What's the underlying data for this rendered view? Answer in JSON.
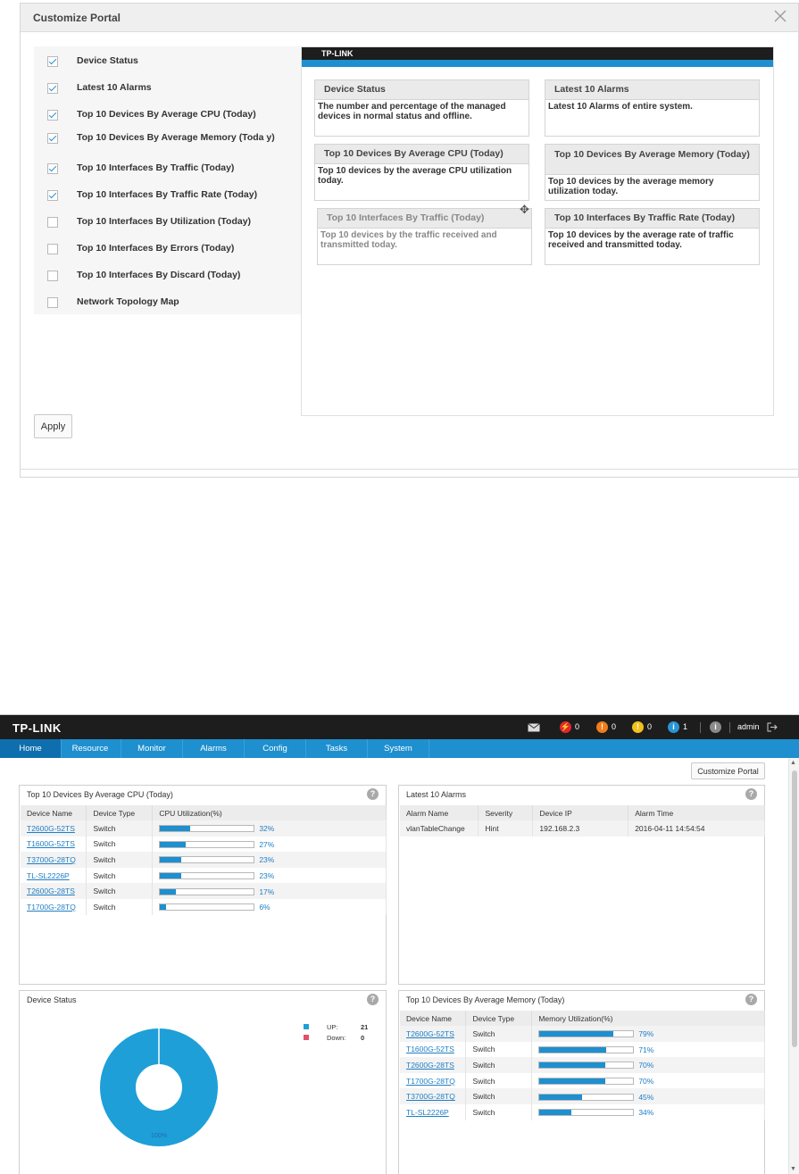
{
  "dialog": {
    "title": "Customize Portal",
    "apply_label": "Apply",
    "options": [
      {
        "label": "Device Status",
        "checked": true
      },
      {
        "label": "Latest 10 Alarms",
        "checked": true
      },
      {
        "label": "Top 10 Devices By Average CPU (Today)",
        "checked": true
      },
      {
        "label": "Top 10 Devices By Average Memory (Toda y)",
        "checked": true
      },
      {
        "label": "Top 10 Interfaces By Traffic (Today)",
        "checked": true
      },
      {
        "label": "Top 10 Interfaces By Traffic Rate (Today)",
        "checked": true
      },
      {
        "label": "Top 10 Interfaces By Utilization (Today)",
        "checked": false
      },
      {
        "label": "Top 10 Interfaces By Errors (Today)",
        "checked": false
      },
      {
        "label": "Top 10 Interfaces By Discard (Today)",
        "checked": false
      },
      {
        "label": "Network Topology Map",
        "checked": false
      }
    ],
    "preview": {
      "logo": "TP-LINK",
      "cards": [
        {
          "title": "Device Status",
          "desc": "The number and percentage of the managed devices in normal status and offline."
        },
        {
          "title": "Latest 10 Alarms",
          "desc": "Latest 10 Alarms of entire system."
        },
        {
          "title": "Top 10 Devices By Average CPU (Today)",
          "desc": "Top 10 devices by the average CPU utilization today."
        },
        {
          "title": "Top 10 Devices By Average Memory (Today)",
          "desc": "Top 10 devices by the average memory utilization today."
        },
        {
          "title": "Top 10 Interfaces By Traffic (Today)",
          "desc": "Top 10 devices by the traffic received and transmitted today."
        },
        {
          "title": "Top 10 Interfaces By Traffic Rate (Today)",
          "desc": "Top 10 devices by the average rate of traffic received and transmitted today."
        }
      ]
    }
  },
  "portal": {
    "logo": "TP-LINK",
    "status": {
      "red": "0",
      "orange": "0",
      "yellow": "0",
      "info": "1",
      "info_icon": "i",
      "user": "admin"
    },
    "nav": [
      "Home",
      "Resource",
      "Monitor",
      "Alarms",
      "Config",
      "Tasks",
      "System"
    ],
    "customize_label": "Customize Portal",
    "help_glyph": "?",
    "cpu": {
      "title": "Top 10 Devices By Average CPU (Today)",
      "headers": [
        "Device Name",
        "Device Type",
        "CPU Utilization(%)"
      ],
      "rows": [
        {
          "name": "T2600G-52TS",
          "type": "Switch",
          "util": 32,
          "pct": "32%"
        },
        {
          "name": "T1600G-52TS",
          "type": "Switch",
          "util": 27,
          "pct": "27%"
        },
        {
          "name": "T3700G-28TQ",
          "type": "Switch",
          "util": 23,
          "pct": "23%"
        },
        {
          "name": "TL-SL2226P",
          "type": "Switch",
          "util": 23,
          "pct": "23%"
        },
        {
          "name": "T2600G-28TS",
          "type": "Switch",
          "util": 17,
          "pct": "17%"
        },
        {
          "name": "T1700G-28TQ",
          "type": "Switch",
          "util": 6,
          "pct": "6%"
        }
      ]
    },
    "alarms": {
      "title": "Latest 10 Alarms",
      "headers": [
        "Alarm Name",
        "Severity",
        "Device IP",
        "Alarm Time"
      ],
      "rows": [
        {
          "name": "vlanTableChange",
          "severity": "Hint",
          "ip": "192.168.2.3",
          "time": "2016-04-11 14:54:54"
        }
      ]
    },
    "device_status": {
      "title": "Device Status",
      "legend": [
        {
          "label": "UP:",
          "value": "21",
          "color": "#1e9fd8"
        },
        {
          "label": "Down:",
          "value": "0",
          "color": "#e0506a"
        }
      ],
      "donut_label": "100%",
      "up_fraction": 1.0
    },
    "memory": {
      "title": "Top 10 Devices By Average Memory (Today)",
      "headers": [
        "Device Name",
        "Device Type",
        "Memory Utilization(%)"
      ],
      "rows": [
        {
          "name": "T2600G-52TS",
          "type": "Switch",
          "util": 79,
          "pct": "79%"
        },
        {
          "name": "T1600G-52TS",
          "type": "Switch",
          "util": 71,
          "pct": "71%"
        },
        {
          "name": "T2600G-28TS",
          "type": "Switch",
          "util": 70,
          "pct": "70%"
        },
        {
          "name": "T1700G-28TQ",
          "type": "Switch",
          "util": 70,
          "pct": "70%"
        },
        {
          "name": "T3700G-28TQ",
          "type": "Switch",
          "util": 45,
          "pct": "45%"
        },
        {
          "name": "TL-SL2226P",
          "type": "Switch",
          "util": 34,
          "pct": "34%"
        }
      ]
    }
  }
}
